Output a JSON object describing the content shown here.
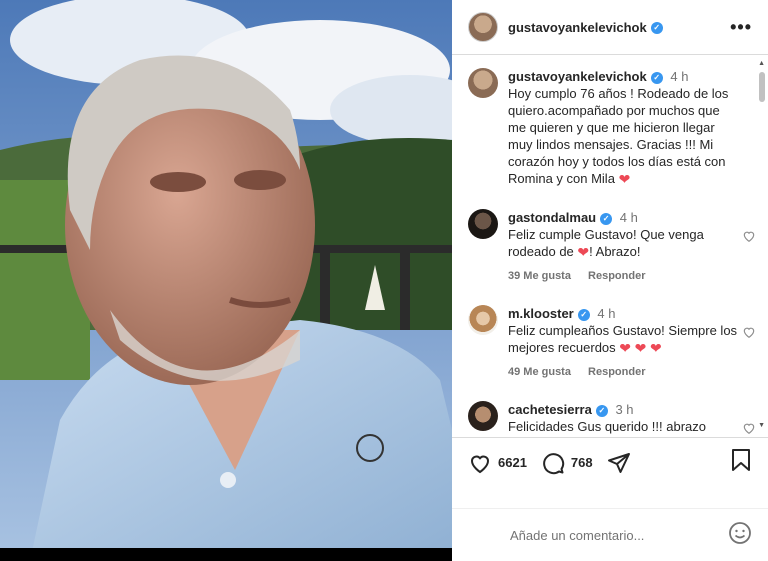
{
  "post": {
    "username": "gustavoyankelevichok",
    "caption": {
      "time": "4 h",
      "text": "Hoy cumplo 76 años ! Rodeado de los quiero.acompañado por muchos que me quieren y que me hicieron llegar muy lindos mensajes. Gracias !!! Mi corazón hoy y todos los días está con Romina y con Mila"
    },
    "comments": [
      {
        "username": "gastondalmau",
        "time": "4 h",
        "text_before": "Feliz cumple Gustavo! Que venga rodeado de",
        "text_after": "! Abrazo!",
        "likes": "39 Me gusta",
        "reply": "Responder"
      },
      {
        "username": "m.klooster",
        "time": "4 h",
        "text_before": "Feliz cumpleaños Gustavo! Siempre los mejores recuerdos",
        "text_after": "",
        "likes": "49 Me gusta",
        "reply": "Responder"
      },
      {
        "username": "cachetesierra",
        "time": "3 h",
        "text_before": "Felicidades Gus querido !!! abrazo",
        "text_after": ""
      }
    ],
    "likes_count": "6621",
    "comments_count": "768",
    "comment_placeholder": "Añade un comentario...",
    "heart_emoji": "❤",
    "verified_mark": "✓",
    "more_label": "•••"
  },
  "colors": {
    "verified": "#3897f0",
    "heart": "#ed4956",
    "muted": "#737373"
  },
  "icons": [
    "more-options-icon",
    "like-icon",
    "comment-icon",
    "share-icon",
    "bookmark-icon",
    "emoji-icon",
    "verified-icon",
    "heart-icon"
  ]
}
